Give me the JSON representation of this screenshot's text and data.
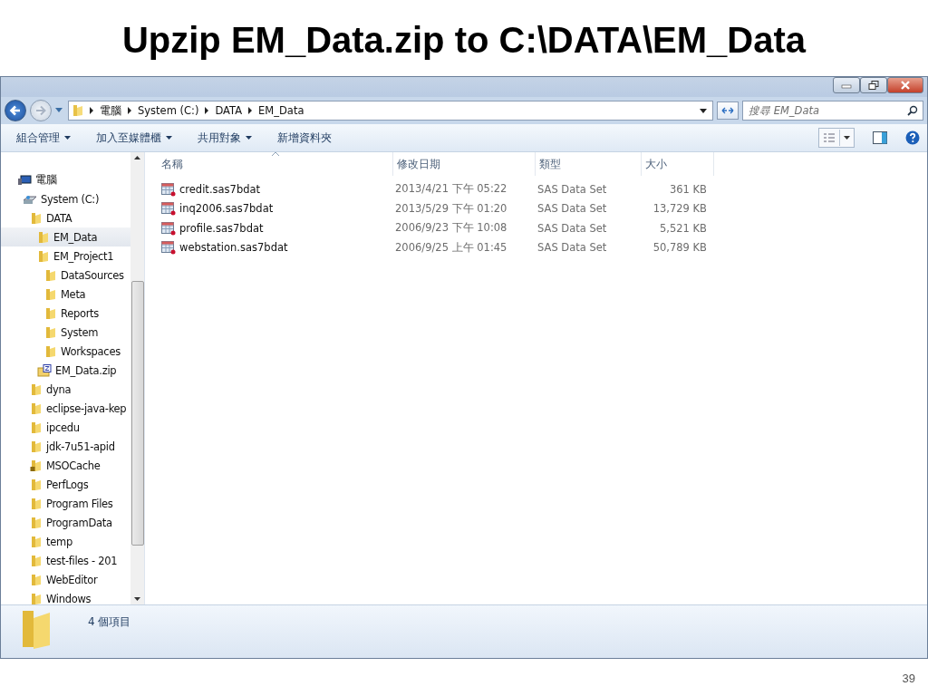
{
  "slide": {
    "title": "Upzip EM_Data.zip to C:\\DATA\\EM_Data",
    "page_number": "39"
  },
  "address_bar": {
    "crumbs": [
      "電腦",
      "System (C:)",
      "DATA",
      "EM_Data"
    ]
  },
  "search": {
    "placeholder": "搜尋 EM_Data"
  },
  "toolbar": {
    "items": [
      {
        "label": "組合管理",
        "dropdown": true
      },
      {
        "label": "加入至媒體櫃",
        "dropdown": true
      },
      {
        "label": "共用對象",
        "dropdown": true
      },
      {
        "label": "新增資料夾",
        "dropdown": false
      }
    ]
  },
  "sidebar": {
    "tree": [
      {
        "label": "電腦",
        "kind": "computer",
        "selected": false,
        "children": [
          {
            "label": "System (C:)",
            "kind": "drive",
            "selected": false,
            "children": [
              {
                "label": "DATA",
                "kind": "folder",
                "selected": false,
                "children": [
                  {
                    "label": "EM_Data",
                    "kind": "folder",
                    "selected": true
                  },
                  {
                    "label": "EM_Project1",
                    "kind": "folder",
                    "selected": false,
                    "children": [
                      {
                        "label": "DataSources",
                        "kind": "folder",
                        "selected": false
                      },
                      {
                        "label": "Meta",
                        "kind": "folder",
                        "selected": false
                      },
                      {
                        "label": "Reports",
                        "kind": "folder",
                        "selected": false
                      },
                      {
                        "label": "System",
                        "kind": "folder",
                        "selected": false
                      },
                      {
                        "label": "Workspaces",
                        "kind": "folder",
                        "selected": false
                      }
                    ]
                  },
                  {
                    "label": "EM_Data.zip",
                    "kind": "zip",
                    "selected": false
                  }
                ]
              },
              {
                "label": "dyna",
                "kind": "folder",
                "selected": false
              },
              {
                "label": "eclipse-java-kep",
                "kind": "folder",
                "selected": false
              },
              {
                "label": "ipcedu",
                "kind": "folder",
                "selected": false
              },
              {
                "label": "jdk-7u51-apid",
                "kind": "folder",
                "selected": false
              },
              {
                "label": "MSOCache",
                "kind": "locked-folder",
                "selected": false
              },
              {
                "label": "PerfLogs",
                "kind": "folder",
                "selected": false
              },
              {
                "label": "Program Files",
                "kind": "folder",
                "selected": false
              },
              {
                "label": "ProgramData",
                "kind": "folder",
                "selected": false
              },
              {
                "label": "temp",
                "kind": "folder",
                "selected": false
              },
              {
                "label": "test-files - 201",
                "kind": "folder",
                "selected": false
              },
              {
                "label": "WebEditor",
                "kind": "folder",
                "selected": false
              },
              {
                "label": "Windows",
                "kind": "folder",
                "selected": false
              }
            ]
          }
        ]
      }
    ]
  },
  "table": {
    "columns": [
      {
        "label": "名稱",
        "sorted": true
      },
      {
        "label": "修改日期",
        "sorted": false
      },
      {
        "label": "類型",
        "sorted": false
      },
      {
        "label": "大小",
        "sorted": false
      }
    ],
    "rows": [
      {
        "name": "credit.sas7bdat",
        "modified": "2013/4/21 下午 05:22",
        "type": "SAS Data Set",
        "size": "361 KB"
      },
      {
        "name": "inq2006.sas7bdat",
        "modified": "2013/5/29 下午 01:20",
        "type": "SAS Data Set",
        "size": "13,729 KB"
      },
      {
        "name": "profile.sas7bdat",
        "modified": "2006/9/23 下午 10:08",
        "type": "SAS Data Set",
        "size": "5,521 KB"
      },
      {
        "name": "webstation.sas7bdat",
        "modified": "2006/9/25 上午 01:45",
        "type": "SAS Data Set",
        "size": "50,789 KB"
      }
    ]
  },
  "status_bar": {
    "text": "4 個項目"
  }
}
